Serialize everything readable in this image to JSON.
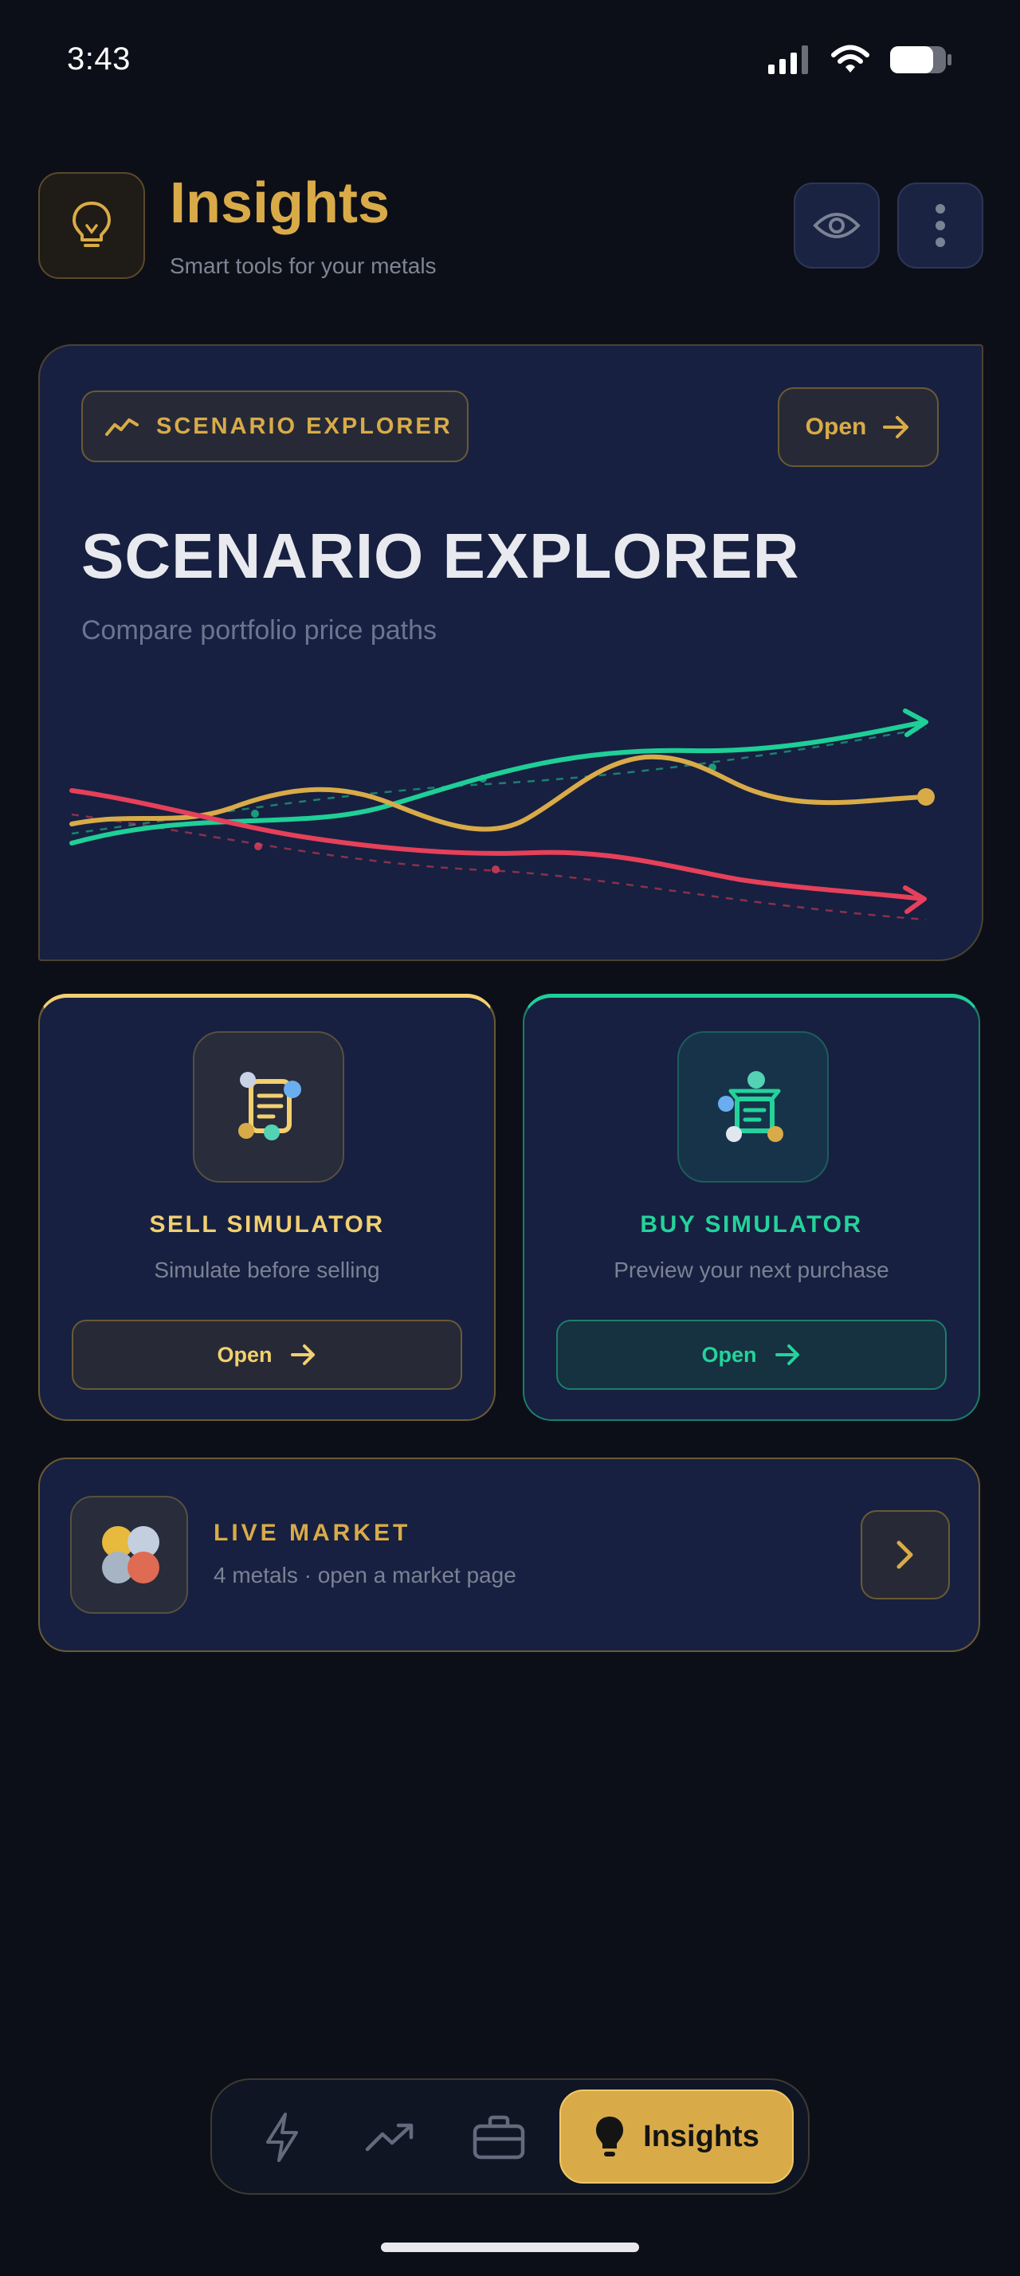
{
  "status_bar": {
    "time": "3:43"
  },
  "header": {
    "title": "Insights",
    "subtitle": "Smart tools for your metals",
    "icon": "lightbulb-icon",
    "actions": [
      {
        "icon": "eye-icon"
      },
      {
        "icon": "more-vertical-icon"
      }
    ]
  },
  "scenario": {
    "chip_label": "SCENARIO EXPLORER",
    "chip_icon": "trend-line-icon",
    "open_label": "Open",
    "title": "SCENARIO EXPLORER",
    "subtitle": "Compare portfolio price paths",
    "chart_colors": {
      "up": "#1fcf97",
      "mid": "#d9ab48",
      "down": "#e6405a"
    }
  },
  "sell_simulator": {
    "title": "SELL SIMULATOR",
    "subtitle": "Simulate before selling",
    "open_label": "Open",
    "icon": "sell-receipt-icon",
    "accent": "#f2d070"
  },
  "buy_simulator": {
    "title": "BUY SIMULATOR",
    "subtitle": "Preview your next purchase",
    "open_label": "Open",
    "icon": "buy-cart-icon",
    "accent": "#24d39b"
  },
  "live_market": {
    "title": "LIVE MARKET",
    "subtitle": "4 metals · open a market page",
    "icon": "metal-coins-icon"
  },
  "bottom_nav": {
    "items": [
      {
        "icon": "lightning-icon"
      },
      {
        "icon": "trending-up-icon"
      },
      {
        "icon": "briefcase-icon"
      },
      {
        "icon": "lightbulb-icon",
        "label": "Insights",
        "active": true
      }
    ]
  }
}
